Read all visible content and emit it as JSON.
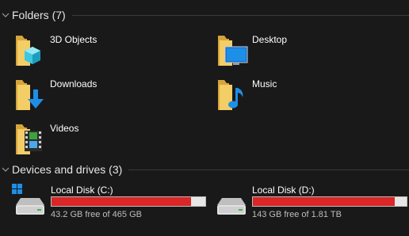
{
  "groups": {
    "folders": {
      "title": "Folders (7)"
    },
    "drives": {
      "title": "Devices and drives (3)"
    }
  },
  "folders": [
    {
      "label": "3D Objects",
      "icon": "3d-objects-folder-icon"
    },
    {
      "label": "Desktop",
      "icon": "desktop-folder-icon"
    },
    {
      "label": "Downloads",
      "icon": "downloads-folder-icon"
    },
    {
      "label": "Music",
      "icon": "music-folder-icon"
    },
    {
      "label": "Videos",
      "icon": "videos-folder-icon"
    }
  ],
  "drives": [
    {
      "label": "Local Disk (C:)",
      "free_text": "43.2 GB free of 465 GB",
      "used_fraction": 0.907,
      "icon": "system-drive-icon"
    },
    {
      "label": "Local Disk (D:)",
      "free_text": "143 GB free of 1.81 TB",
      "used_fraction": 0.923,
      "icon": "drive-icon"
    }
  ],
  "colors": {
    "background": "#191919",
    "folder_yellow": "#f0c75a",
    "usage_bar_full": "#da2626",
    "usage_bar_track": "#e6e6e6",
    "accent_blue": "#1e8fe6"
  }
}
